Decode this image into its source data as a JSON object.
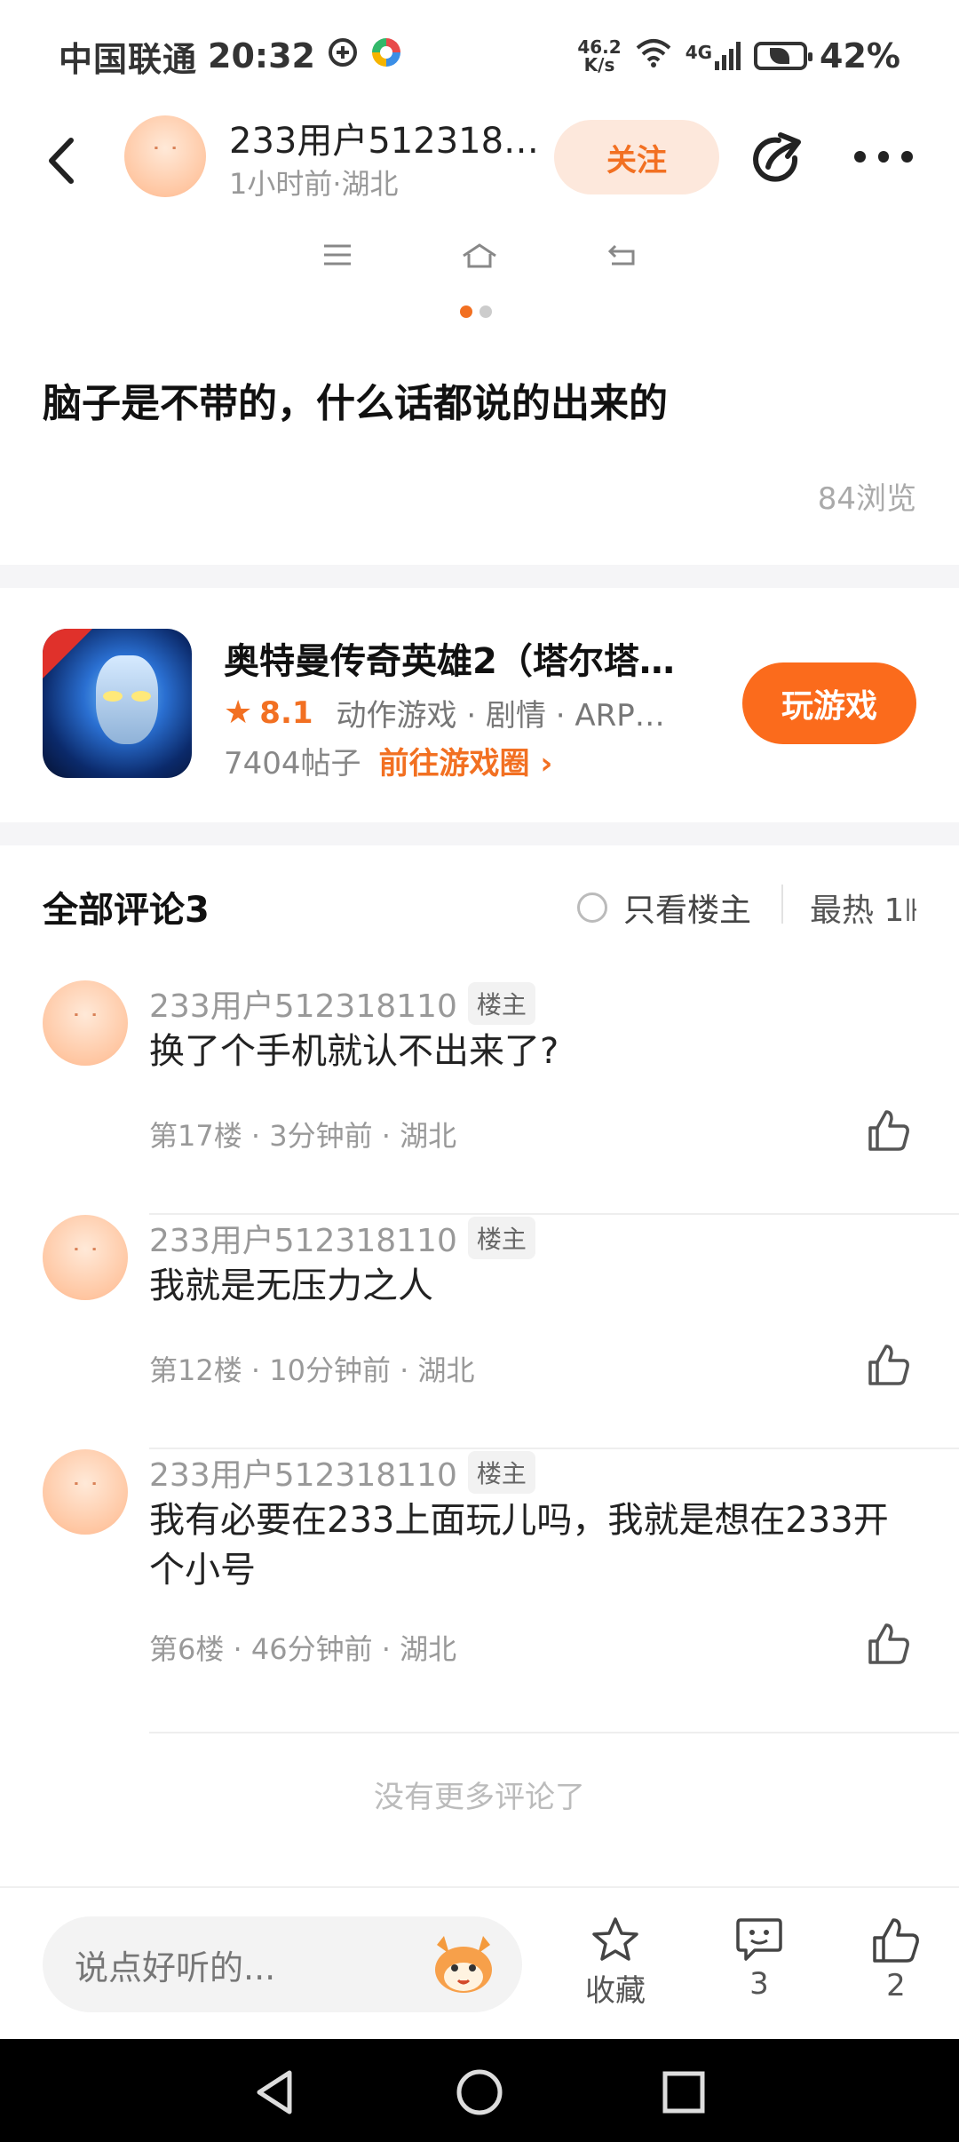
{
  "status_bar": {
    "carrier": "中国联通",
    "time": "20:32",
    "net_speed_value": "46.2",
    "net_speed_unit": "K/s",
    "signal": "4G",
    "battery": "42%"
  },
  "header": {
    "author_name": "233用户5123181…",
    "author_meta": "1小时前·湖北",
    "follow_label": "关注"
  },
  "post": {
    "title": "脑子是不带的，什么话都说的出来的",
    "views": "84浏览"
  },
  "game": {
    "name": "奥特曼传奇英雄2（塔尔塔…",
    "rating": "8.1",
    "genre": "动作游戏 · 剧情 · ARP…",
    "posts": "7404帖子",
    "goto_label": "前往游戏圈 ›",
    "play_label": "玩游戏"
  },
  "comments_section": {
    "header": "全部评论3",
    "only_owner_label": "只看楼主",
    "sort_label": "最热 1⊩",
    "no_more": "没有更多评论了",
    "items": [
      {
        "name": "233用户512318110",
        "tag": "楼主",
        "text": "换了个手机就认不出来了?",
        "meta": "第17楼 · 3分钟前 · 湖北"
      },
      {
        "name": "233用户512318110",
        "tag": "楼主",
        "text": "我就是无压力之人",
        "meta": "第12楼 · 10分钟前 · 湖北"
      },
      {
        "name": "233用户512318110",
        "tag": "楼主",
        "text": "我有必要在233上面玩儿吗，我就是想在233开个小号",
        "meta": "第6楼 · 46分钟前 · 湖北"
      }
    ]
  },
  "bottom_bar": {
    "input_placeholder": "说点好听的...",
    "favorite_label": "收藏",
    "comment_count": "3",
    "like_count": "2"
  },
  "colors": {
    "accent": "#f27022",
    "play_button": "#fb6b1c",
    "follow_bg": "#fde8dc"
  }
}
